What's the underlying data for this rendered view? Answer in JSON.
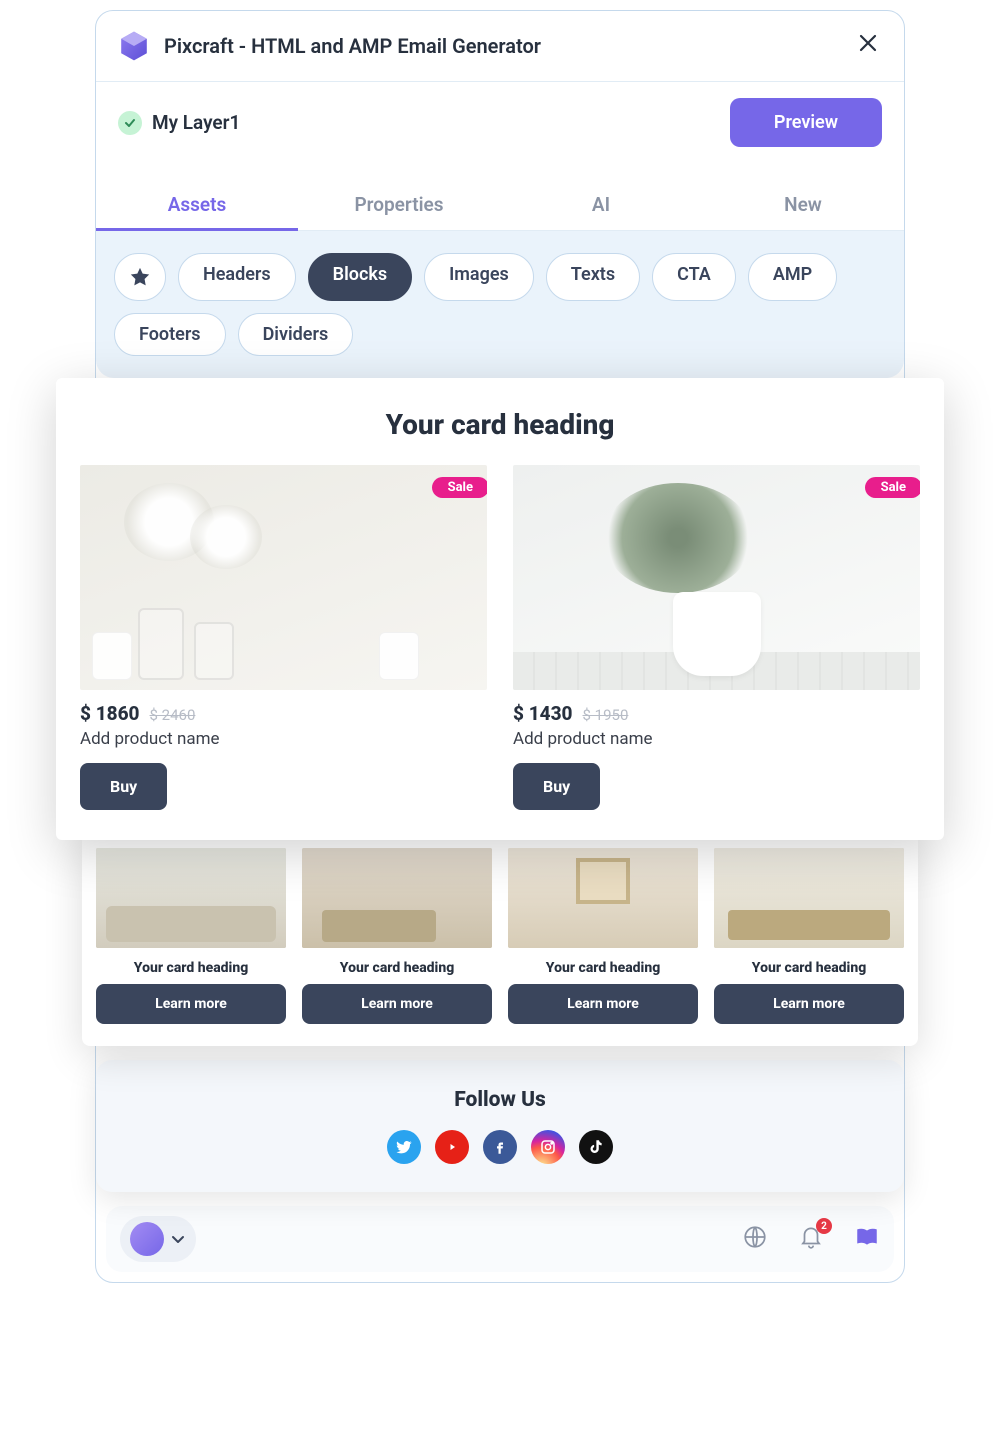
{
  "titlebar": {
    "title": "Pixcraft  - HTML and AMP Email Generator"
  },
  "layer": {
    "name": "My Layer1",
    "preview_label": "Preview"
  },
  "tabs": {
    "assets": "Assets",
    "properties": "Properties",
    "ai": "AI",
    "new": "New"
  },
  "filters": {
    "headers": "Headers",
    "blocks": "Blocks",
    "images": "Images",
    "texts": "Texts",
    "cta": "CTA",
    "amp": "AMP",
    "footers": "Footers",
    "dividers": "Dividers"
  },
  "card": {
    "heading": "Your card heading",
    "products": [
      {
        "sale": "Sale",
        "price": "$ 1860",
        "old": "$ 2460",
        "name": "Add product name",
        "buy": "Buy"
      },
      {
        "sale": "Sale",
        "price": "$ 1430",
        "old": "$ 1950",
        "name": "Add product name",
        "buy": "Buy"
      }
    ]
  },
  "thumbs": {
    "heading": "Your card heading",
    "learn": "Learn more"
  },
  "follow": {
    "title": "Follow Us"
  },
  "bottombar": {
    "notif_count": "2"
  }
}
